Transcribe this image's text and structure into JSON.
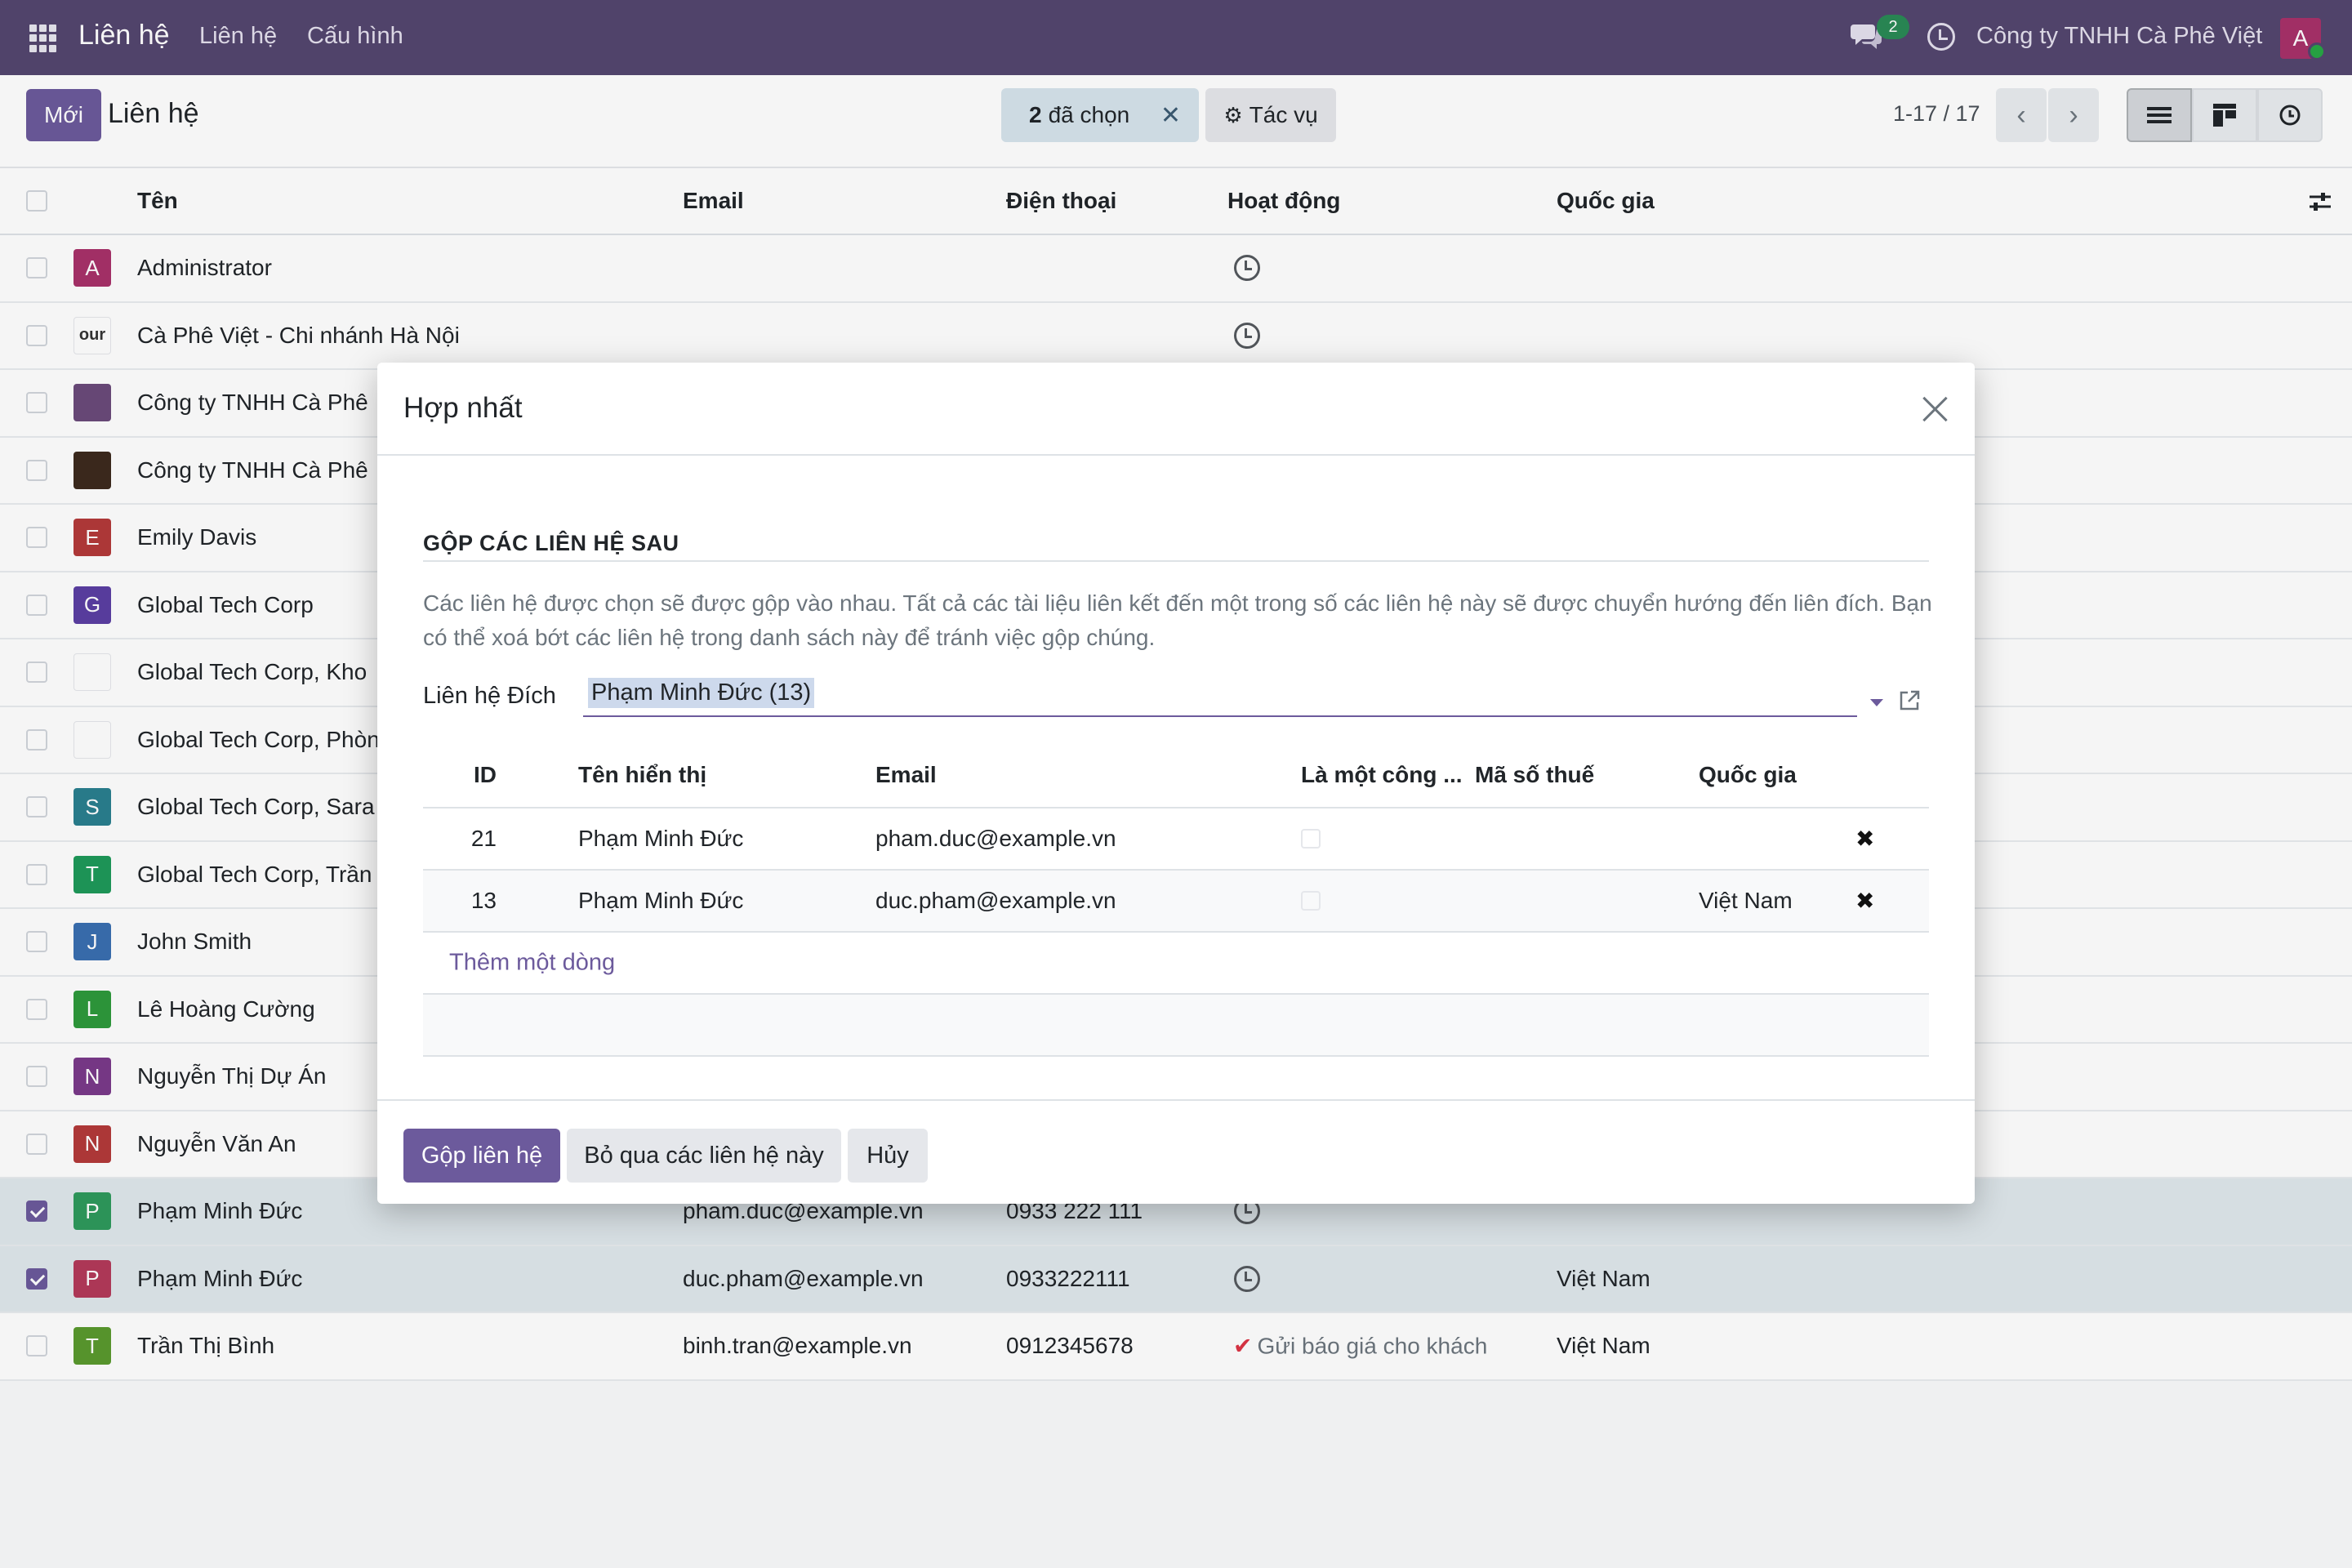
{
  "navbar": {
    "brand": "Liên hệ",
    "menu": [
      "Liên hệ",
      "Cấu hình"
    ],
    "chat_count": "2",
    "company": "Công ty TNHH Cà Phê Việt",
    "avatar_letter": "A"
  },
  "control": {
    "new_label": "Mới",
    "title": "Liên hệ",
    "selected_count": "2",
    "selected_label": "đã chọn",
    "action_label": "Tác vụ",
    "pager": "1-17 / 17"
  },
  "list": {
    "columns": [
      "Tên",
      "Email",
      "Điện thoại",
      "Hoạt động",
      "Quốc gia"
    ],
    "rows": [
      {
        "avatar": "A",
        "color": "#a8316a",
        "name": "Administrator",
        "email": "",
        "phone": "",
        "activity": "clock",
        "country": "",
        "checked": false
      },
      {
        "avatar": "our",
        "color": "#ffffff",
        "name": "Cà Phê Việt - Chi nhánh Hà Nội",
        "email": "",
        "phone": "",
        "activity": "clock",
        "country": "",
        "checked": false
      },
      {
        "avatar": "",
        "color": "#6b4a7a",
        "name": "Công ty TNHH Cà Phê",
        "email": "",
        "phone": "",
        "activity": "",
        "country": "",
        "checked": false
      },
      {
        "avatar": "",
        "color": "#3d2a1e",
        "name": "Công ty TNHH Cà Phê",
        "email": "",
        "phone": "",
        "activity": "",
        "country": "",
        "checked": false
      },
      {
        "avatar": "E",
        "color": "#b43a3a",
        "name": "Emily Davis",
        "email": "",
        "phone": "",
        "activity": "",
        "country": "",
        "checked": false
      },
      {
        "avatar": "G",
        "color": "#5b3fa3",
        "name": "Global Tech Corp",
        "email": "",
        "phone": "",
        "activity": "",
        "country": "",
        "checked": false
      },
      {
        "avatar": "",
        "color": "#ffffff",
        "name": "Global Tech Corp, Kho",
        "email": "",
        "phone": "",
        "activity": "",
        "country": "",
        "checked": false
      },
      {
        "avatar": "",
        "color": "#ffffff",
        "name": "Global Tech Corp, Phòn",
        "email": "",
        "phone": "",
        "activity": "",
        "country": "",
        "checked": false
      },
      {
        "avatar": "S",
        "color": "#2a7f8f",
        "name": "Global Tech Corp, Sara",
        "email": "",
        "phone": "",
        "activity": "",
        "country": "",
        "checked": false
      },
      {
        "avatar": "T",
        "color": "#1f9a5a",
        "name": "Global Tech Corp, Trần",
        "email": "",
        "phone": "",
        "activity": "",
        "country": "",
        "checked": false
      },
      {
        "avatar": "J",
        "color": "#3a6fb0",
        "name": "John Smith",
        "email": "",
        "phone": "",
        "activity": "",
        "country": "",
        "checked": false
      },
      {
        "avatar": "L",
        "color": "#2e9a3c",
        "name": "Lê Hoàng Cường",
        "email": "",
        "phone": "",
        "activity": "",
        "country": "",
        "checked": false
      },
      {
        "avatar": "N",
        "color": "#7a3a8a",
        "name": "Nguyễn Thị Dự Án",
        "email": "",
        "phone": "",
        "activity": "",
        "country": "",
        "checked": false
      },
      {
        "avatar": "N",
        "color": "#b43a3a",
        "name": "Nguyễn Văn An",
        "email": "",
        "phone": "",
        "activity": "",
        "country": "",
        "checked": false
      },
      {
        "avatar": "P",
        "color": "#2e9a5c",
        "name": "Phạm Minh Đức",
        "email": "pham.duc@example.vn",
        "phone": "0933 222 111",
        "activity": "clock",
        "country": "",
        "checked": true
      },
      {
        "avatar": "P",
        "color": "#b43a5a",
        "name": "Phạm Minh Đức",
        "email": "duc.pham@example.vn",
        "phone": "0933222111",
        "activity": "clock",
        "country": "Việt Nam",
        "checked": true
      },
      {
        "avatar": "T",
        "color": "#5a9a2e",
        "name": "Trần Thị Bình",
        "email": "binh.tran@example.vn",
        "phone": "0912345678",
        "activity": "Gửi báo giá cho khách",
        "country": "Việt Nam",
        "checked": false
      }
    ]
  },
  "modal": {
    "title": "Hợp nhất",
    "section": "GỘP CÁC LIÊN HỆ SAU",
    "help": "Các liên hệ được chọn sẽ được gộp vào nhau. Tất cả các tài liệu liên kết đến một trong số các liên hệ này sẽ được chuyển hướng đến liên đích. Bạn có thể xoá bớt các liên hệ trong danh sách này để tránh việc gộp chúng.",
    "dest_label": "Liên hệ Đích",
    "dest_value": "Phạm Minh Đức (13)",
    "table": {
      "columns": [
        "ID",
        "Tên hiển thị",
        "Email",
        "Là một công ...",
        "Mã số thuế",
        "Quốc gia"
      ],
      "rows": [
        {
          "id": "21",
          "name": "Phạm Minh Đức",
          "email": "pham.duc@example.vn",
          "vat": "",
          "country": ""
        },
        {
          "id": "13",
          "name": "Phạm Minh Đức",
          "email": "duc.pham@example.vn",
          "vat": "",
          "country": "Việt Nam"
        }
      ],
      "add_line": "Thêm một dòng"
    },
    "buttons": {
      "merge": "Gộp liên hệ",
      "skip": "Bỏ qua các liên hệ này",
      "cancel": "Hủy"
    }
  },
  "colors": {
    "navbar": "#54466f",
    "primary": "#6c5a9c",
    "selected_row": "#dfe8ec",
    "success": "#28a745"
  }
}
